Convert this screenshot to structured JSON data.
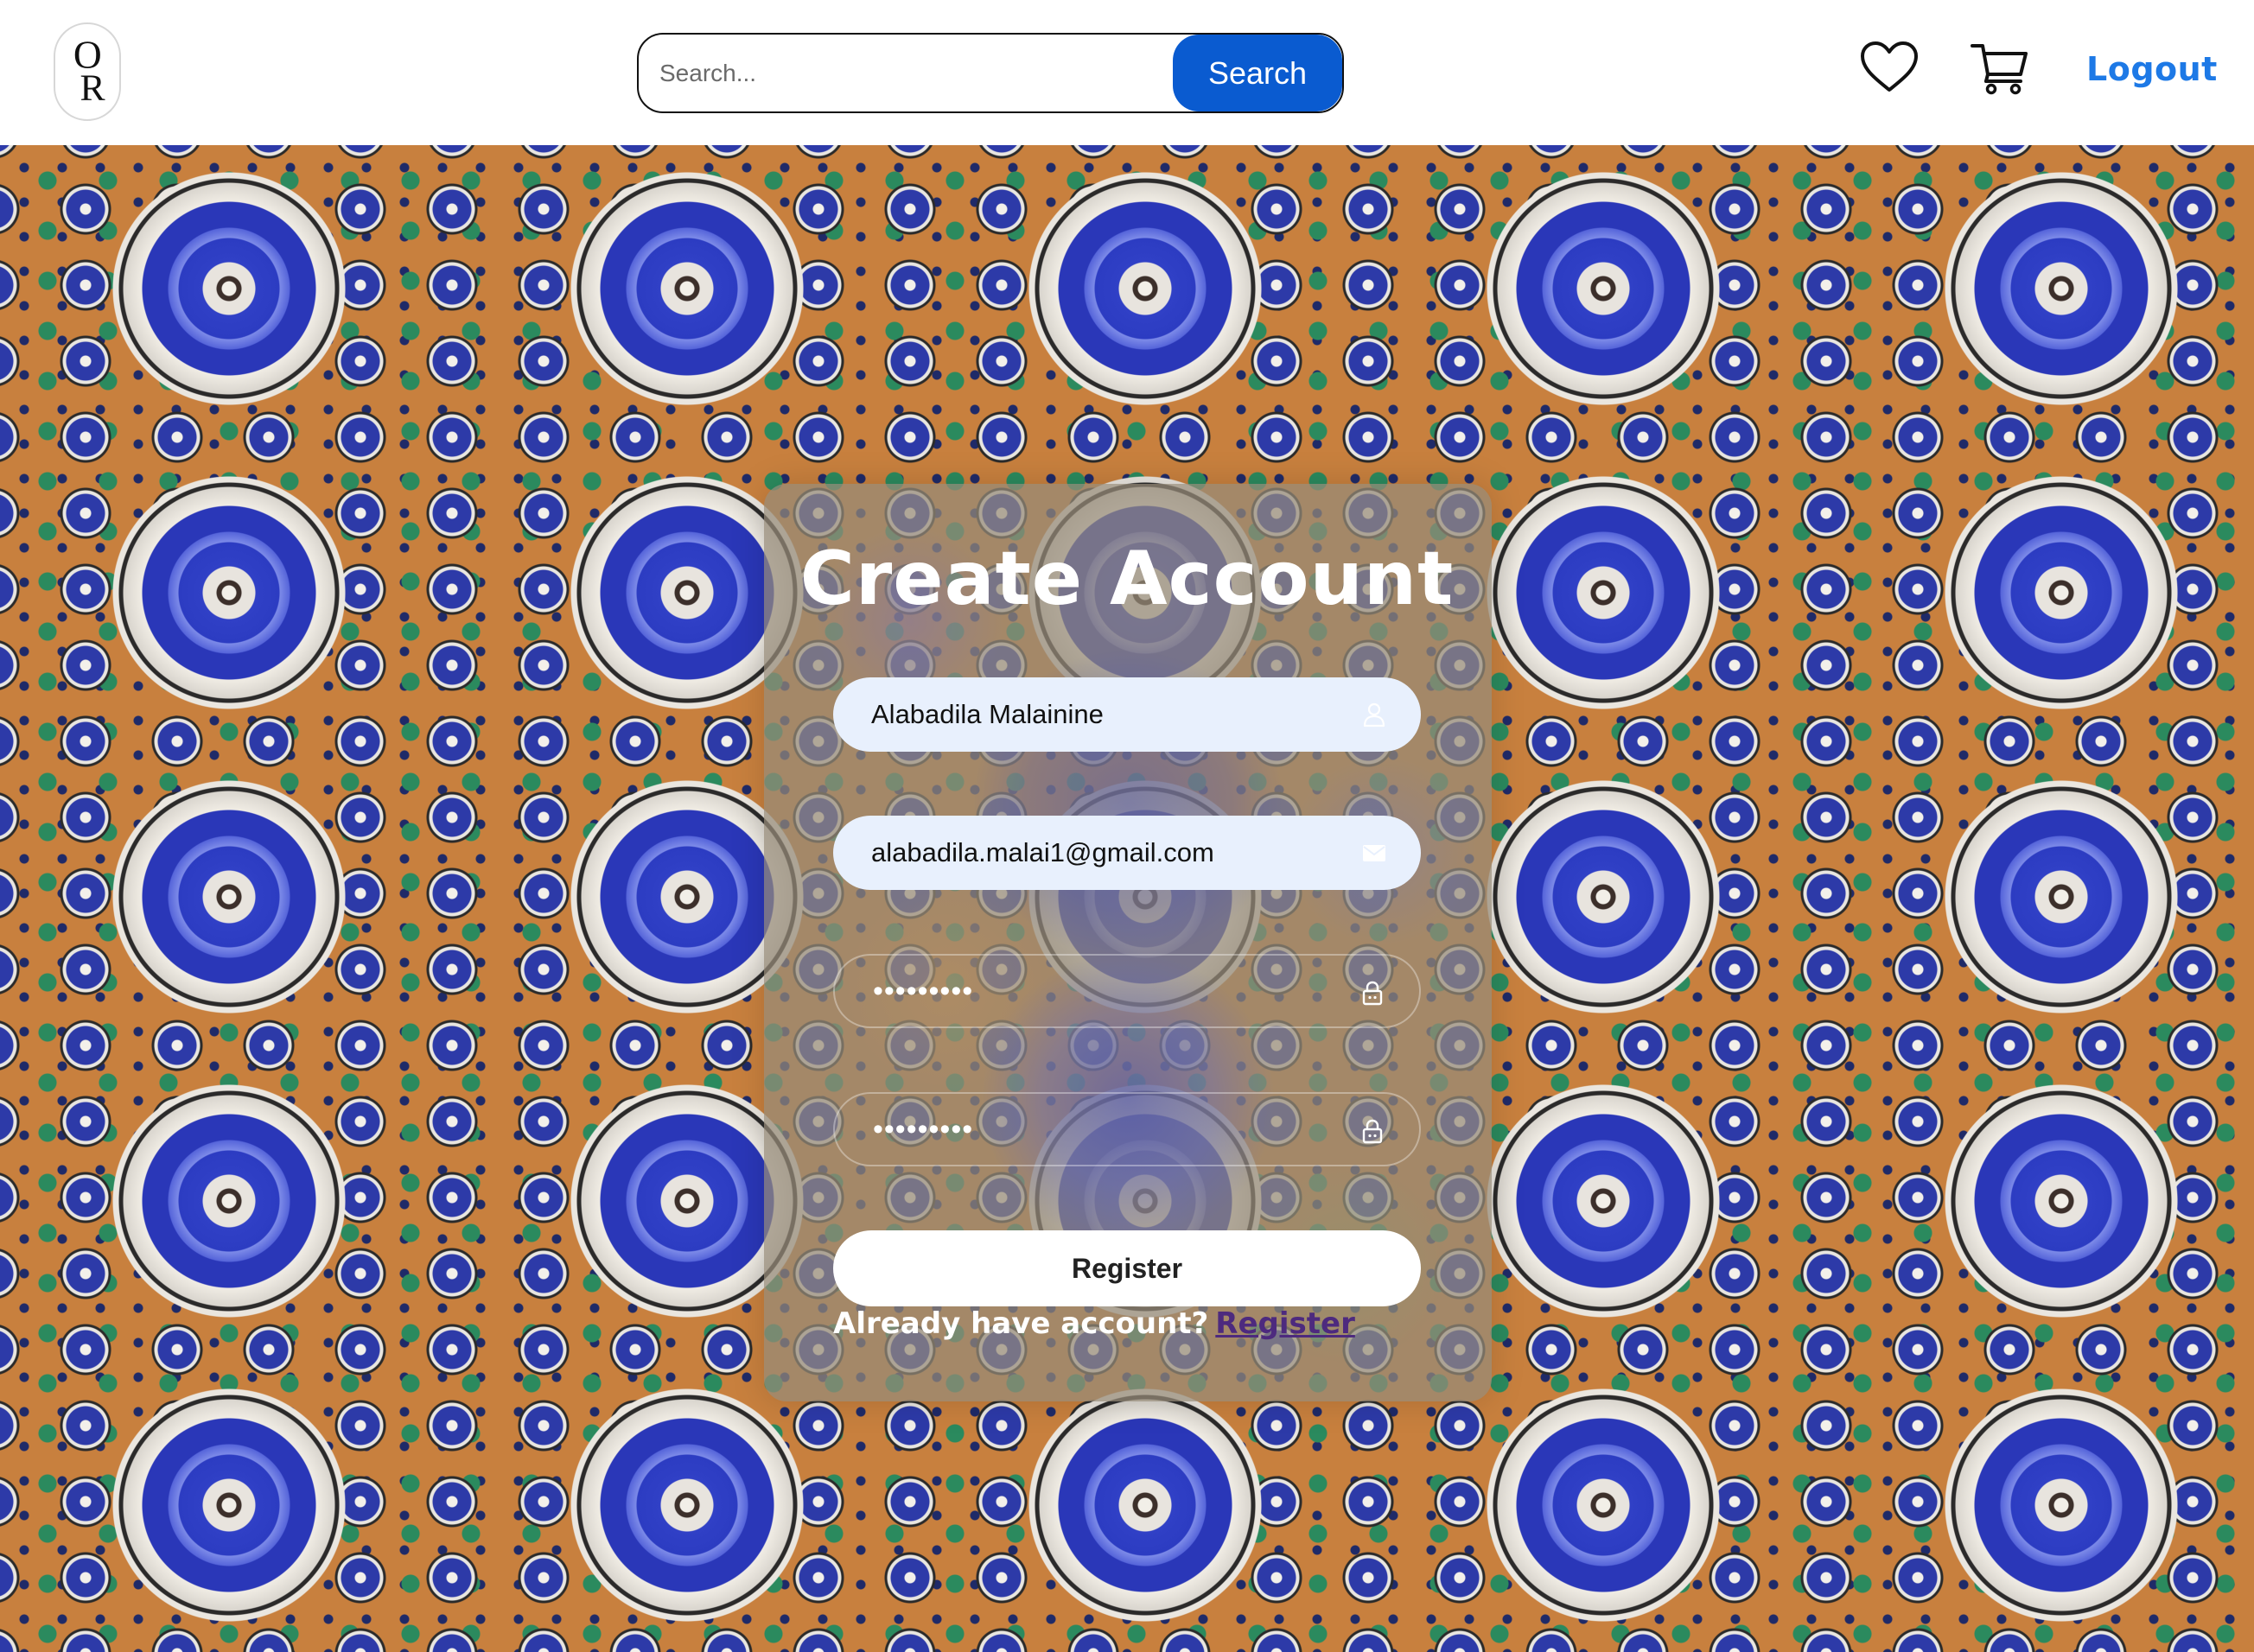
{
  "header": {
    "logo_alt": "OR",
    "search": {
      "placeholder": "Search...",
      "button_label": "Search"
    },
    "wishlist_icon": "heart-icon",
    "cart_icon": "cart-icon",
    "logout_label": "Logout"
  },
  "form": {
    "title": "Create Account",
    "fields": {
      "name": {
        "value": "Alabadila Malainine",
        "icon": "user-icon"
      },
      "email": {
        "value": "alabadila.malai1@gmail.com",
        "icon": "mail-icon"
      },
      "password": {
        "value": "•••••••••",
        "icon": "lock-icon"
      },
      "confirm_password": {
        "value": "•••••••••",
        "icon": "lock-icon"
      }
    },
    "submit_label": "Register",
    "already_text": "Already have account?",
    "login_link_label": "Register"
  },
  "colors": {
    "search_button": "#0a5bd0",
    "logout_link": "#1d79e6",
    "login_link": "#4d2a7e",
    "field_fill": "#e8f0fd"
  }
}
